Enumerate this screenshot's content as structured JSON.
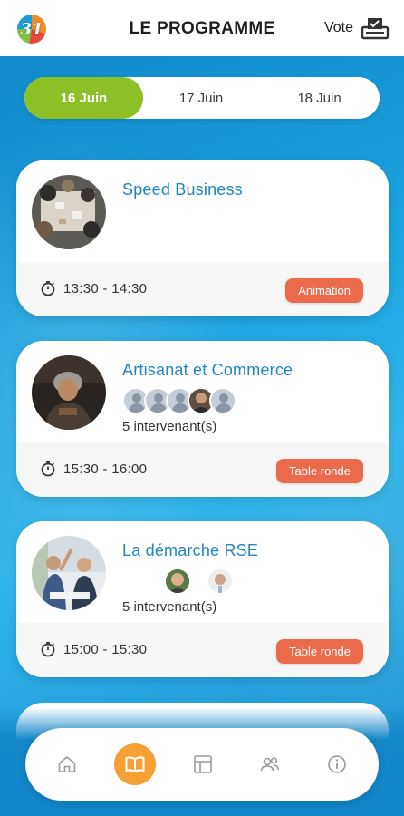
{
  "header": {
    "logo_text": "31",
    "title": "LE PROGRAMME",
    "vote_label": "Vote"
  },
  "tabs": [
    {
      "label": "16 Juin",
      "active": true
    },
    {
      "label": "17 Juin",
      "active": false
    },
    {
      "label": "18 Juin",
      "active": false
    }
  ],
  "sessions": [
    {
      "title": "Speed Business",
      "time": "13:30 - 14:30",
      "category": "Animation",
      "speakers_text": ""
    },
    {
      "title": "Artisanat et Commerce",
      "time": "15:30 - 16:00",
      "category": "Table ronde",
      "speakers_text": "5 intervenant(s)"
    },
    {
      "title": "La démarche RSE",
      "time": "15:00 - 15:30",
      "category": "Table ronde",
      "speakers_text": "5 intervenant(s)"
    }
  ],
  "nav": {
    "items": [
      "home-icon",
      "book-icon",
      "layout-icon",
      "users-icon",
      "info-icon"
    ],
    "active": "book-icon"
  },
  "colors": {
    "accent_green": "#8dbf26",
    "badge": "#ec6a4c",
    "title_blue": "#1f86c1",
    "nav_active": "#f5a033",
    "background": "#1aa0dd"
  }
}
